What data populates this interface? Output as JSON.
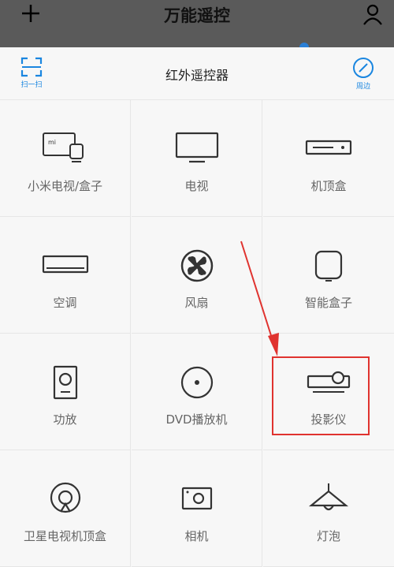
{
  "topbar": {
    "title": "万能遥控"
  },
  "header": {
    "title": "红外遥控器",
    "scan_label": "扫一扫",
    "nearby_label": "周边"
  },
  "devices": [
    {
      "label": "小米电视/盒子",
      "icon": "mi-tv-box-icon"
    },
    {
      "label": "电视",
      "icon": "tv-icon"
    },
    {
      "label": "机顶盒",
      "icon": "set-top-box-icon"
    },
    {
      "label": "空调",
      "icon": "air-conditioner-icon"
    },
    {
      "label": "风扇",
      "icon": "fan-icon"
    },
    {
      "label": "智能盒子",
      "icon": "smart-box-icon"
    },
    {
      "label": "功放",
      "icon": "speaker-icon"
    },
    {
      "label": "DVD播放机",
      "icon": "dvd-icon"
    },
    {
      "label": "投影仪",
      "icon": "projector-icon"
    },
    {
      "label": "卫星电视机顶盒",
      "icon": "satellite-icon"
    },
    {
      "label": "相机",
      "icon": "camera-icon"
    },
    {
      "label": "灯泡",
      "icon": "lamp-icon"
    }
  ],
  "colors": {
    "accent": "#1a86e0",
    "highlight": "#e0332f"
  }
}
